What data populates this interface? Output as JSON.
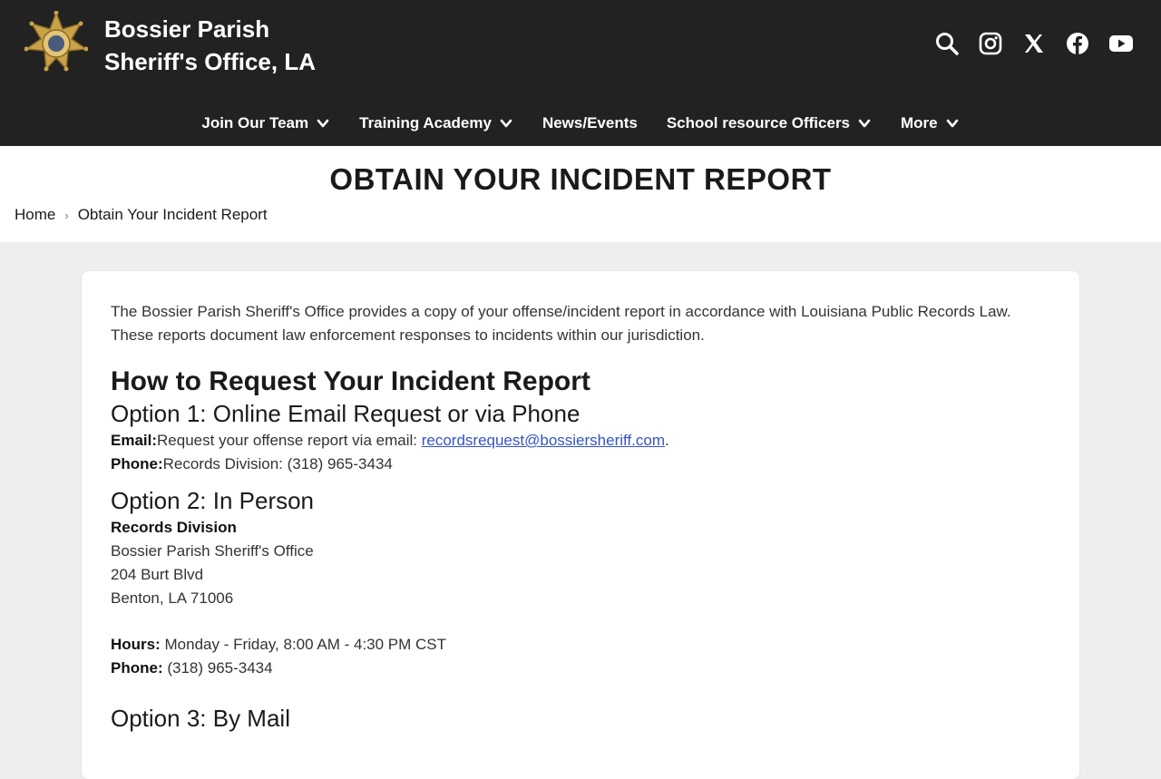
{
  "site": {
    "title_line1": "Bossier Parish",
    "title_line2": "Sheriff's Office, LA"
  },
  "social": [
    {
      "name": "search-icon"
    },
    {
      "name": "instagram-icon"
    },
    {
      "name": "x-icon"
    },
    {
      "name": "facebook-icon"
    },
    {
      "name": "youtube-icon"
    }
  ],
  "nav": {
    "join": "Join Our Team",
    "training": "Training Academy",
    "news": "News/Events",
    "sro": "School resource Officers",
    "more": "More"
  },
  "page": {
    "title": "OBTAIN YOUR INCIDENT REPORT"
  },
  "breadcrumb": {
    "home": "Home",
    "current": "Obtain Your Incident Report"
  },
  "content": {
    "intro": "The Bossier Parish Sheriff's Office provides a copy of your offense/incident report in accordance with Louisiana Public Records Law. These reports document law enforcement responses to incidents within our jurisdiction.",
    "how_heading": "How to Request Your Incident Report",
    "opt1_heading": "Option 1: Online Email Request or via Phone",
    "email_label": "Email:",
    "email_text": "Request your offense report via email: ",
    "email_link": "recordsrequest@bossiersheriff.com",
    "email_after": ".",
    "phone_label": "Phone:",
    "phone_text": "Records Division: (318) 965-3434",
    "opt2_heading": "Option 2: In Person",
    "records_division": "Records Division",
    "addr1": "Bossier Parish Sheriff's Office",
    "addr2": "204 Burt Blvd",
    "addr3": "Benton, LA 71006",
    "hours_label": "Hours:",
    "hours_text": " Monday - Friday, 8:00 AM - 4:30 PM CST",
    "phone2_label": "Phone:",
    "phone2_text": " (318) 965-3434",
    "opt3_heading": "Option 3: By Mail"
  },
  "colors": {
    "topbar": "#222222",
    "link": "#3354c8",
    "badge_gold": "#c9a24a"
  }
}
